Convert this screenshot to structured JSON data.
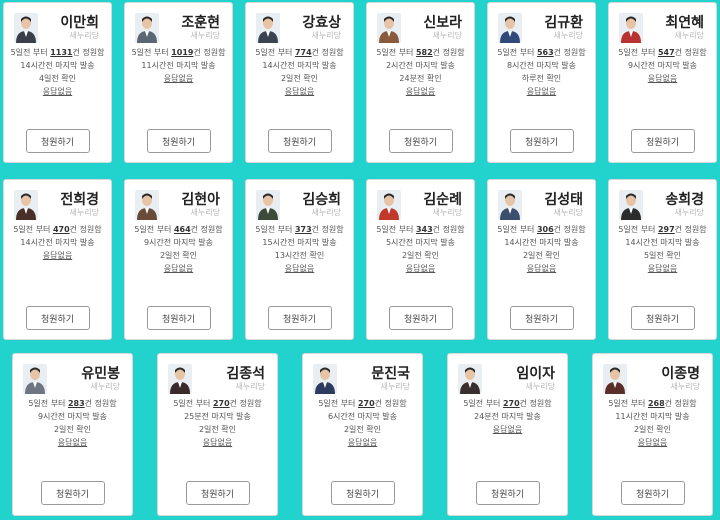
{
  "labels": {
    "since": "5일전 부터",
    "unit": "건 정원함",
    "last_sent_suffix": "마지막 발송",
    "check_suffix": "확인",
    "no_response": "응답없음",
    "petition_button": "청원하기"
  },
  "legislators": [
    {
      "name": "이만희",
      "party": "새누리당",
      "count": "1131",
      "last_sent": "14시간전",
      "checked": "4일전"
    },
    {
      "name": "조훈현",
      "party": "새누리당",
      "count": "1019",
      "last_sent": "11시간전",
      "checked": ""
    },
    {
      "name": "강효상",
      "party": "새누리당",
      "count": "774",
      "last_sent": "14시간전",
      "checked": "2일전"
    },
    {
      "name": "신보라",
      "party": "새누리당",
      "count": "582",
      "last_sent": "2시간전",
      "checked": "24분전"
    },
    {
      "name": "김규환",
      "party": "새누리당",
      "count": "563",
      "last_sent": "8시간전",
      "checked": "하루전"
    },
    {
      "name": "최연혜",
      "party": "새누리당",
      "count": "547",
      "last_sent": "9시간전",
      "checked": ""
    },
    {
      "name": "전희경",
      "party": "새누리당",
      "count": "470",
      "last_sent": "14시간전",
      "checked": ""
    },
    {
      "name": "김현아",
      "party": "새누리당",
      "count": "464",
      "last_sent": "9시간전",
      "checked": "2일전"
    },
    {
      "name": "김승희",
      "party": "새누리당",
      "count": "373",
      "last_sent": "15시간전",
      "checked": "13시간전"
    },
    {
      "name": "김순례",
      "party": "새누리당",
      "count": "343",
      "last_sent": "5시간전",
      "checked": "2일전"
    },
    {
      "name": "김성태",
      "party": "새누리당",
      "count": "306",
      "last_sent": "14시간전",
      "checked": "2일전"
    },
    {
      "name": "송희경",
      "party": "새누리당",
      "count": "297",
      "last_sent": "14시간전",
      "checked": "5일전"
    },
    {
      "name": "유민봉",
      "party": "새누리당",
      "count": "283",
      "last_sent": "9시간전",
      "checked": "2일전"
    },
    {
      "name": "김종석",
      "party": "새누리당",
      "count": "270",
      "last_sent": "25분전",
      "checked": "2일전"
    },
    {
      "name": "문진국",
      "party": "새누리당",
      "count": "270",
      "last_sent": "6시간전",
      "checked": "2일전"
    },
    {
      "name": "임이자",
      "party": "새누리당",
      "count": "270",
      "last_sent": "24분전",
      "checked": ""
    },
    {
      "name": "이종명",
      "party": "새누리당",
      "count": "268",
      "last_sent": "11시간전",
      "checked": "2일전"
    }
  ],
  "photo_colors": [
    "#3a3f4b",
    "#5b6675",
    "#3b4250",
    "#8a5a3c",
    "#2f4a7a",
    "#b83232",
    "#4a2e28",
    "#6a4b3a",
    "#3c4a3a",
    "#c0392b",
    "#3c4e6e",
    "#2c2c2c",
    "#6f7682",
    "#3a2a2a",
    "#2d3c5e",
    "#3a2f2f",
    "#5a2f2a"
  ]
}
